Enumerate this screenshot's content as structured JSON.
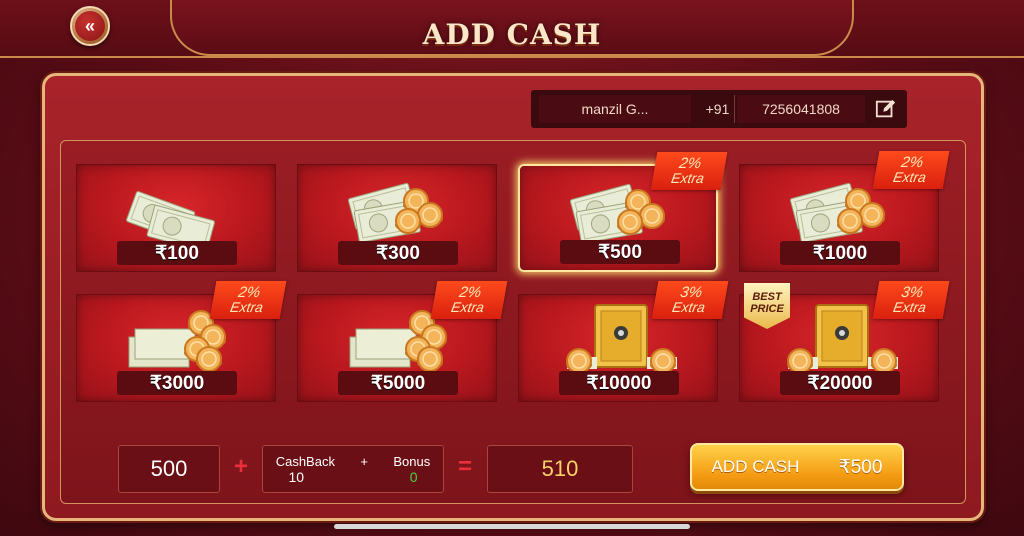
{
  "header": {
    "title": "ADD CASH"
  },
  "user": {
    "name": "manzil G...",
    "country_code": "+91",
    "phone": "7256041808"
  },
  "packages": [
    {
      "amount": "₹100",
      "extra_pct": "",
      "extra_label": "",
      "best_price": false,
      "selected": false,
      "art": "notes"
    },
    {
      "amount": "₹300",
      "extra_pct": "",
      "extra_label": "",
      "best_price": false,
      "selected": false,
      "art": "notes-coins"
    },
    {
      "amount": "₹500",
      "extra_pct": "2%",
      "extra_label": "Extra",
      "best_price": false,
      "selected": true,
      "art": "notes-coins"
    },
    {
      "amount": "₹1000",
      "extra_pct": "2%",
      "extra_label": "Extra",
      "best_price": false,
      "selected": false,
      "art": "notes-coins"
    },
    {
      "amount": "₹3000",
      "extra_pct": "2%",
      "extra_label": "Extra",
      "best_price": false,
      "selected": false,
      "art": "stack-coins"
    },
    {
      "amount": "₹5000",
      "extra_pct": "2%",
      "extra_label": "Extra",
      "best_price": false,
      "selected": false,
      "art": "stack-coins"
    },
    {
      "amount": "₹10000",
      "extra_pct": "3%",
      "extra_label": "Extra",
      "best_price": false,
      "selected": false,
      "art": "safe"
    },
    {
      "amount": "₹20000",
      "extra_pct": "3%",
      "extra_label": "Extra",
      "best_price": true,
      "best_line1": "BEST",
      "best_line2": "PRICE",
      "selected": false,
      "art": "safe"
    }
  ],
  "summary": {
    "amount": "500",
    "plus": "+",
    "cashback_label": "CashBack",
    "inner_plus": "+",
    "bonus_label": "Bonus",
    "cashback_value": "10",
    "bonus_value": "0",
    "equals": "=",
    "total": "510"
  },
  "add_button": {
    "label": "ADD CASH",
    "amount": "₹500"
  },
  "colors": {
    "accent_gold": "#f49a12",
    "panel_red": "#a8232a",
    "extra_badge": "#ff4a1c",
    "bonus_green": "#4bd04b"
  },
  "icons": {
    "back": "back-arrow-icon",
    "edit": "edit-icon"
  }
}
